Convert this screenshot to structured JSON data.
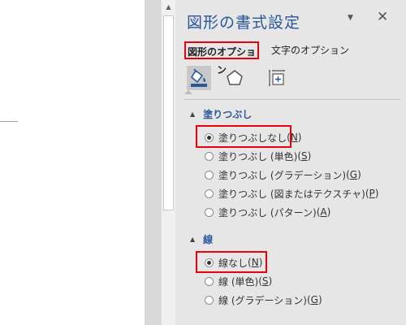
{
  "pane": {
    "title": "図形の書式設定",
    "dropdown_glyph": "▼",
    "close_glyph": "✕",
    "tabs": [
      {
        "label": "図形のオプション",
        "selected": true
      },
      {
        "label": "文字のオプション",
        "selected": false
      }
    ],
    "category_icons": [
      {
        "name": "fill-line-icon",
        "selected": true
      },
      {
        "name": "pentagon-effects-icon",
        "selected": false
      },
      {
        "name": "size-properties-icon",
        "selected": false
      }
    ]
  },
  "fill": {
    "header": "塗りつぶし",
    "options": [
      {
        "text": "塗りつぶしなし",
        "key": "N",
        "checked": true
      },
      {
        "text": "塗りつぶし (単色)",
        "key": "S",
        "checked": false
      },
      {
        "text": "塗りつぶし (グラデーション)",
        "key": "G",
        "checked": false
      },
      {
        "text": "塗りつぶし (図またはテクスチャ)",
        "key": "P",
        "checked": false
      },
      {
        "text": "塗りつぶし (パターン)",
        "key": "A",
        "checked": false
      }
    ]
  },
  "line": {
    "header": "線",
    "options": [
      {
        "text": "線なし",
        "key": "N",
        "checked": true
      },
      {
        "text": "線 (単色)",
        "key": "S",
        "checked": false
      },
      {
        "text": "線 (グラデーション)",
        "key": "G",
        "checked": false
      }
    ]
  },
  "colors": {
    "accent": "#2b579a",
    "highlight": "#e8000b",
    "pane_bg": "#e6e6e6"
  }
}
